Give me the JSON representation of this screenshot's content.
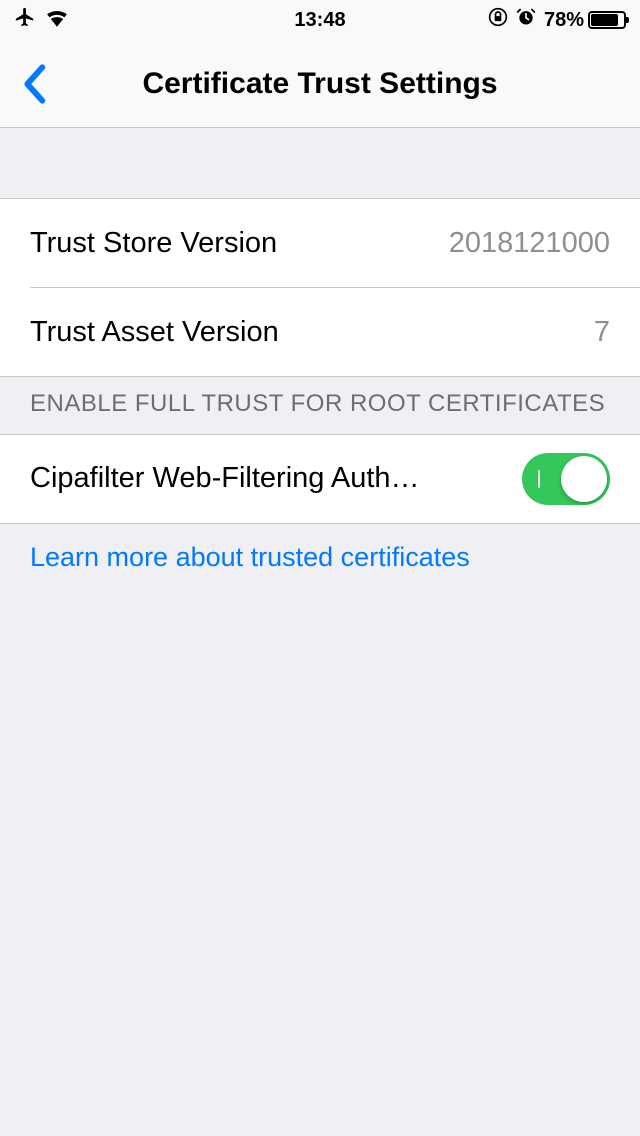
{
  "status_bar": {
    "time": "13:48",
    "battery_percent": "78%"
  },
  "nav": {
    "title": "Certificate Trust Settings"
  },
  "version_group": {
    "trust_store": {
      "label": "Trust Store Version",
      "value": "2018121000"
    },
    "trust_asset": {
      "label": "Trust Asset Version",
      "value": "7"
    }
  },
  "root_certs": {
    "header": "ENABLE FULL TRUST FOR ROOT CERTIFICATES",
    "items": [
      {
        "label": "Cipafilter Web-Filtering Auth…",
        "enabled": true
      }
    ],
    "footer_link": "Learn more about trusted certificates"
  }
}
